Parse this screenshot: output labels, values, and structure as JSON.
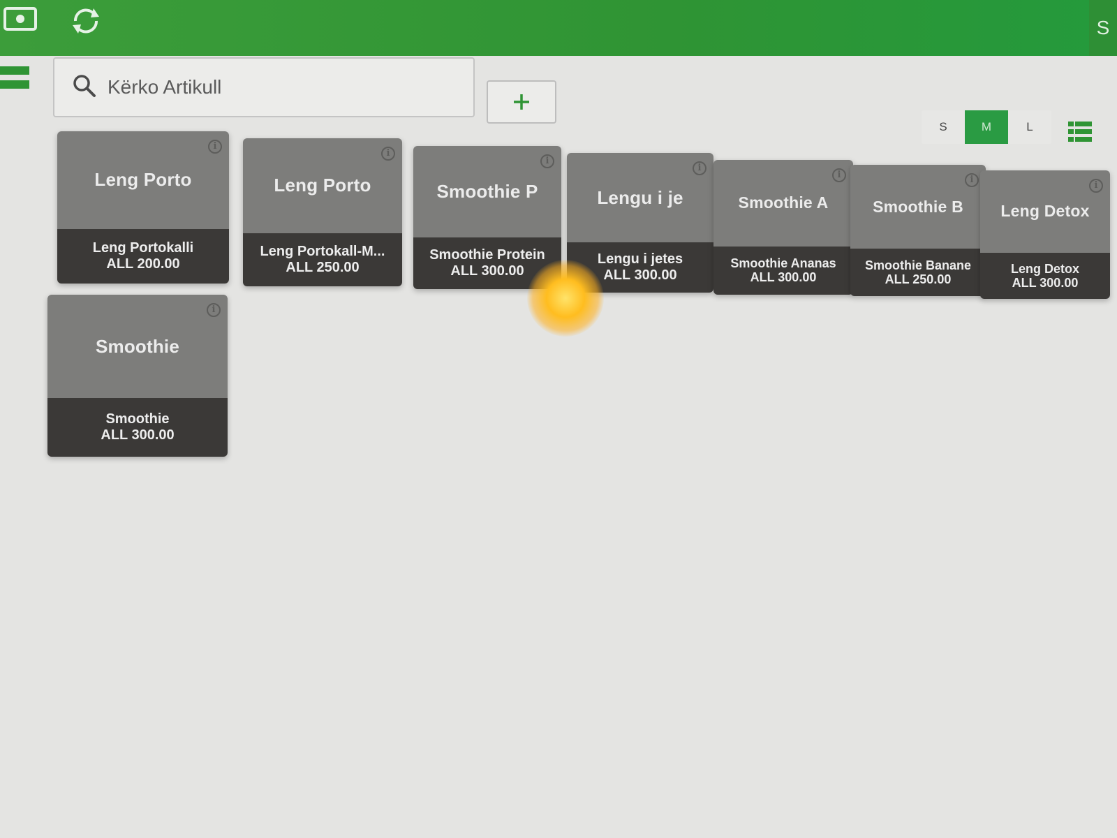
{
  "topbar": {
    "icons": [
      "camera-icon",
      "sync-icon"
    ],
    "user_letter": "S"
  },
  "search": {
    "placeholder": "Kërko Artikull",
    "value": "",
    "icon": "search-icon"
  },
  "add_button": {
    "label": "+"
  },
  "size_toggle": {
    "options": [
      "S",
      "M",
      "L"
    ],
    "selected": "M"
  },
  "list_view_icon": "list-view-icon",
  "colors": {
    "brand_green": "#2f9434",
    "tile_top": "#7d7d7b",
    "tile_bottom": "#3b3937",
    "active_toggle": "#2a9b43"
  },
  "products": [
    {
      "short": "Leng Porto",
      "name": "Leng Portokalli",
      "price": "ALL 200.00"
    },
    {
      "short": "Leng Porto",
      "name": "Leng Portokall-M...",
      "price": "ALL 250.00"
    },
    {
      "short": "Smoothie P",
      "name": "Smoothie Protein",
      "price": "ALL 300.00"
    },
    {
      "short": "Lengu i je",
      "name": "Lengu i jetes",
      "price": "ALL 300.00"
    },
    {
      "short": "Smoothie A",
      "name": "Smoothie Ananas",
      "price": "ALL 300.00"
    },
    {
      "short": "Smoothie B",
      "name": "Smoothie Banane",
      "price": "ALL 250.00"
    },
    {
      "short": "Leng Detox",
      "name": "Leng Detox",
      "price": "ALL 300.00"
    },
    {
      "short": "Smoothie",
      "name": "Smoothie",
      "price": "ALL 300.00"
    }
  ]
}
